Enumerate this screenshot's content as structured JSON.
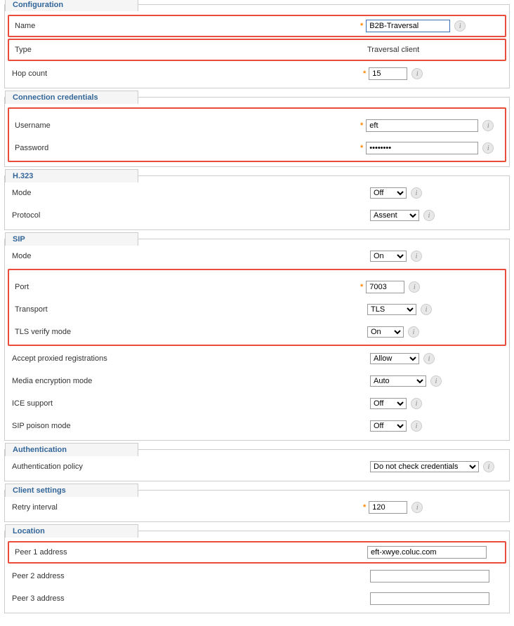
{
  "sections": {
    "configuration": {
      "title": "Configuration",
      "name": {
        "label": "Name",
        "value": "B2B-Traversal",
        "required": true
      },
      "type": {
        "label": "Type",
        "value": "Traversal client"
      },
      "hopcount": {
        "label": "Hop count",
        "value": "15",
        "required": true
      }
    },
    "credentials": {
      "title": "Connection credentials",
      "username": {
        "label": "Username",
        "value": "eft",
        "required": true
      },
      "password": {
        "label": "Password",
        "value": "••••••••",
        "required": true
      }
    },
    "h323": {
      "title": "H.323",
      "mode": {
        "label": "Mode",
        "value": "Off"
      },
      "protocol": {
        "label": "Protocol",
        "value": "Assent"
      }
    },
    "sip": {
      "title": "SIP",
      "mode": {
        "label": "Mode",
        "value": "On"
      },
      "port": {
        "label": "Port",
        "value": "7003",
        "required": true
      },
      "transport": {
        "label": "Transport",
        "value": "TLS"
      },
      "tlsverify": {
        "label": "TLS verify mode",
        "value": "On"
      },
      "acceptproxied": {
        "label": "Accept proxied registrations",
        "value": "Allow"
      },
      "mediaenc": {
        "label": "Media encryption mode",
        "value": "Auto"
      },
      "ice": {
        "label": "ICE support",
        "value": "Off"
      },
      "poison": {
        "label": "SIP poison mode",
        "value": "Off"
      }
    },
    "auth": {
      "title": "Authentication",
      "policy": {
        "label": "Authentication policy",
        "value": "Do not check credentials"
      }
    },
    "client": {
      "title": "Client settings",
      "retry": {
        "label": "Retry interval",
        "value": "120",
        "required": true
      }
    },
    "location": {
      "title": "Location",
      "peer1": {
        "label": "Peer 1 address",
        "value": "eft-xwye.coluc.com"
      },
      "peer2": {
        "label": "Peer 2 address",
        "value": ""
      },
      "peer3": {
        "label": "Peer 3 address",
        "value": ""
      }
    }
  }
}
